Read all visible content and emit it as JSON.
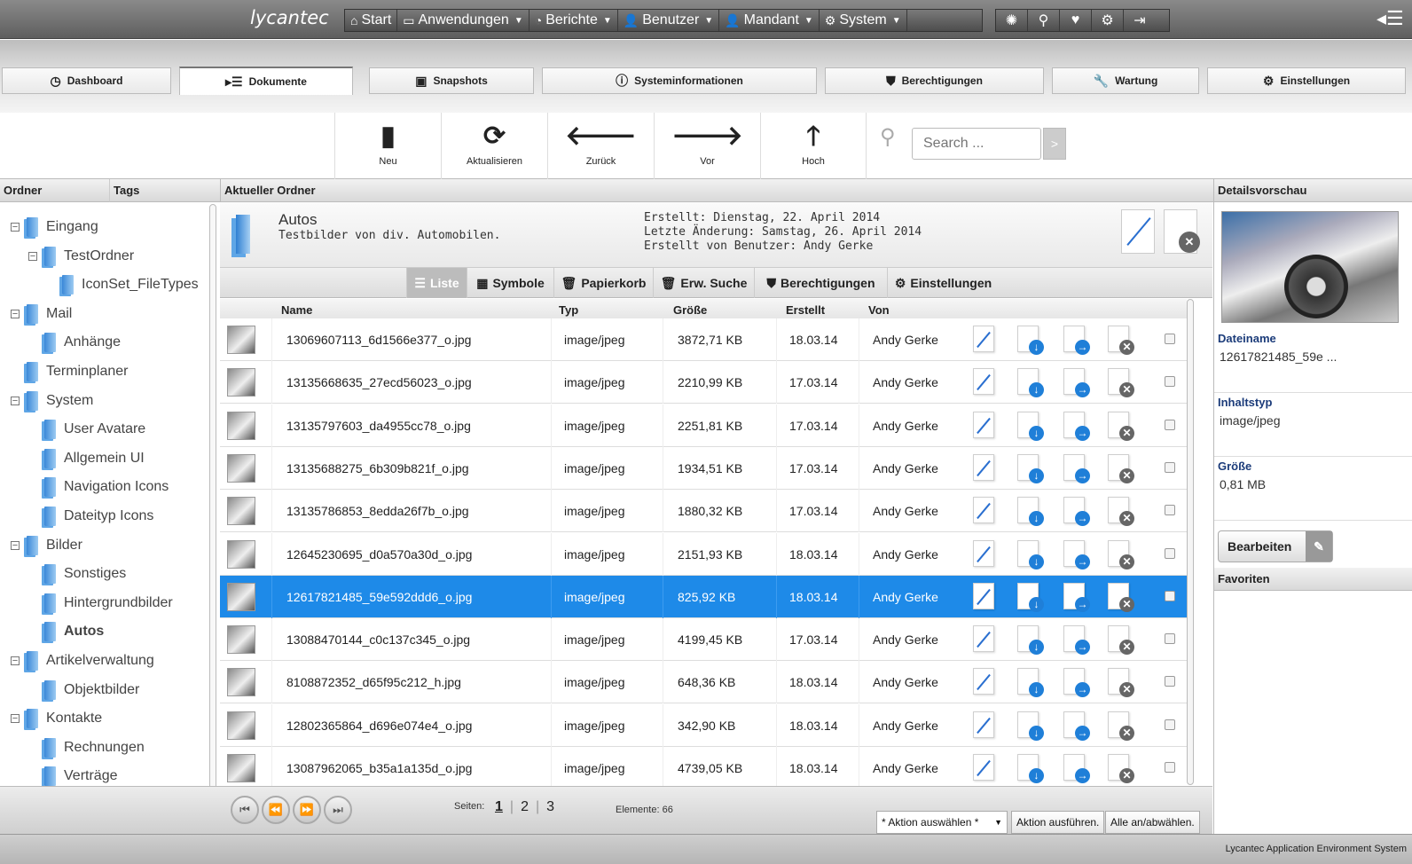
{
  "app": {
    "logo": "lycantec",
    "footer": "Lycantec Application Environment System"
  },
  "top_menu": [
    {
      "icon": "⌂",
      "label": "Start",
      "caret": false
    },
    {
      "icon": "▭",
      "label": "Anwendungen",
      "caret": true
    },
    {
      "icon": "◔",
      "label": "Berichte",
      "caret": true
    },
    {
      "icon": "👤",
      "label": "Benutzer",
      "caret": true
    },
    {
      "icon": "👤",
      "label": "Mandant",
      "caret": true
    },
    {
      "icon": "⚙",
      "label": "System",
      "caret": true
    }
  ],
  "top_icons": [
    "lifebuoy-icon",
    "search-icon",
    "heart-icon",
    "gear-icon",
    "logout-icon"
  ],
  "tabs": [
    "Dashboard",
    "Dokumente",
    "Snapshots",
    "Systeminformationen",
    "Berechtigungen",
    "Wartung",
    "Einstellungen"
  ],
  "active_tab": "Dokumente",
  "toolbar": {
    "neu": "Neu",
    "aktualisieren": "Aktualisieren",
    "zurueck": "Zurück",
    "vor": "Vor",
    "hoch": "Hoch"
  },
  "search": {
    "placeholder": "Search ...",
    "go": ">"
  },
  "panels": {
    "ordner": "Ordner",
    "tags": "Tags",
    "aktueller_ordner": "Aktueller Ordner",
    "detailsvorschau": "Detailsvorschau",
    "favoriten": "Favoriten"
  },
  "tree": [
    {
      "label": "Eingang",
      "level": 0,
      "toggle": "−"
    },
    {
      "label": "TestOrdner",
      "level": 1,
      "toggle": "−"
    },
    {
      "label": "IconSet_FileTypes",
      "level": 2,
      "toggle": ""
    },
    {
      "label": "Mail",
      "level": 0,
      "toggle": "−"
    },
    {
      "label": "Anhänge",
      "level": 1,
      "toggle": ""
    },
    {
      "label": "Terminplaner",
      "level": 0,
      "toggle": ""
    },
    {
      "label": "System",
      "level": 0,
      "toggle": "−"
    },
    {
      "label": "User Avatare",
      "level": 1,
      "toggle": ""
    },
    {
      "label": "Allgemein UI",
      "level": 1,
      "toggle": ""
    },
    {
      "label": "Navigation Icons",
      "level": 1,
      "toggle": ""
    },
    {
      "label": "Dateityp Icons",
      "level": 1,
      "toggle": ""
    },
    {
      "label": "Bilder",
      "level": 0,
      "toggle": "−"
    },
    {
      "label": "Sonstiges",
      "level": 1,
      "toggle": ""
    },
    {
      "label": "Hintergrundbilder",
      "level": 1,
      "toggle": ""
    },
    {
      "label": "Autos",
      "level": 1,
      "toggle": "",
      "bold": true
    },
    {
      "label": "Artikelverwaltung",
      "level": 0,
      "toggle": "−"
    },
    {
      "label": "Objektbilder",
      "level": 1,
      "toggle": ""
    },
    {
      "label": "Kontakte",
      "level": 0,
      "toggle": "−"
    },
    {
      "label": "Rechnungen",
      "level": 1,
      "toggle": ""
    },
    {
      "label": "Verträge",
      "level": 1,
      "toggle": ""
    }
  ],
  "folder": {
    "name": "Autos",
    "description": "Testbilder von div. Automobilen.",
    "created": "Erstellt: Dienstag, 22. April 2014",
    "modified": "Letzte Änderung: Samstag, 26. April 2014",
    "created_by": "Erstellt von Benutzer: Andy Gerke"
  },
  "view_tabs": [
    {
      "icon": "☰",
      "label": "Liste"
    },
    {
      "icon": "▦",
      "label": "Symbole"
    },
    {
      "icon": "🗑",
      "label": "Papierkorb"
    },
    {
      "icon": "🗑",
      "label": "Erw. Suche"
    },
    {
      "icon": "⛊",
      "label": "Berechtigungen"
    },
    {
      "icon": "⚙",
      "label": "Einstellungen"
    }
  ],
  "active_view": "Liste",
  "columns": {
    "name": "Name",
    "typ": "Typ",
    "groesse": "Größe",
    "erstellt": "Erstellt",
    "von": "Von"
  },
  "files": [
    {
      "name": "13069607113_6d1566e377_o.jpg",
      "typ": "image/jpeg",
      "groesse": "3872,71 KB",
      "erstellt": "18.03.14",
      "von": "Andy Gerke"
    },
    {
      "name": "13135668635_27ecd56023_o.jpg",
      "typ": "image/jpeg",
      "groesse": "2210,99 KB",
      "erstellt": "17.03.14",
      "von": "Andy Gerke"
    },
    {
      "name": "13135797603_da4955cc78_o.jpg",
      "typ": "image/jpeg",
      "groesse": "2251,81 KB",
      "erstellt": "17.03.14",
      "von": "Andy Gerke"
    },
    {
      "name": "13135688275_6b309b821f_o.jpg",
      "typ": "image/jpeg",
      "groesse": "1934,51 KB",
      "erstellt": "17.03.14",
      "von": "Andy Gerke"
    },
    {
      "name": "13135786853_8edda26f7b_o.jpg",
      "typ": "image/jpeg",
      "groesse": "1880,32 KB",
      "erstellt": "17.03.14",
      "von": "Andy Gerke"
    },
    {
      "name": "12645230695_d0a570a30d_o.jpg",
      "typ": "image/jpeg",
      "groesse": "2151,93 KB",
      "erstellt": "18.03.14",
      "von": "Andy Gerke"
    },
    {
      "name": "12617821485_59e592ddd6_o.jpg",
      "typ": "image/jpeg",
      "groesse": "825,92 KB",
      "erstellt": "18.03.14",
      "von": "Andy Gerke",
      "selected": true
    },
    {
      "name": "13088470144_c0c137c345_o.jpg",
      "typ": "image/jpeg",
      "groesse": "4199,45 KB",
      "erstellt": "17.03.14",
      "von": "Andy Gerke"
    },
    {
      "name": "8108872352_d65f95c212_h.jpg",
      "typ": "image/jpeg",
      "groesse": "648,36 KB",
      "erstellt": "18.03.14",
      "von": "Andy Gerke"
    },
    {
      "name": "12802365864_d696e074e4_o.jpg",
      "typ": "image/jpeg",
      "groesse": "342,90 KB",
      "erstellt": "18.03.14",
      "von": "Andy Gerke"
    },
    {
      "name": "13087962065_b35a1a135d_o.jpg",
      "typ": "image/jpeg",
      "groesse": "4739,05 KB",
      "erstellt": "18.03.14",
      "von": "Andy Gerke"
    }
  ],
  "pager": {
    "seiten_label": "Seiten:",
    "pages": [
      "1",
      "2",
      "3"
    ],
    "current": "1",
    "elements": "Elemente: 66",
    "action_select": "* Aktion auswählen *",
    "action_run": "Aktion ausführen.",
    "toggle_all": "Alle an/abwählen."
  },
  "details": {
    "dateiname_label": "Dateiname",
    "dateiname": "12617821485_59e ...",
    "inhaltstyp_label": "Inhaltstyp",
    "inhaltstyp": "image/jpeg",
    "groesse_label": "Größe",
    "groesse": "0,81 MB",
    "edit_button": "Bearbeiten"
  },
  "colors": {
    "selected_row": "#1e8ae8",
    "label_blue": "#1c3c7a",
    "topbar": "#6e6e6e"
  }
}
